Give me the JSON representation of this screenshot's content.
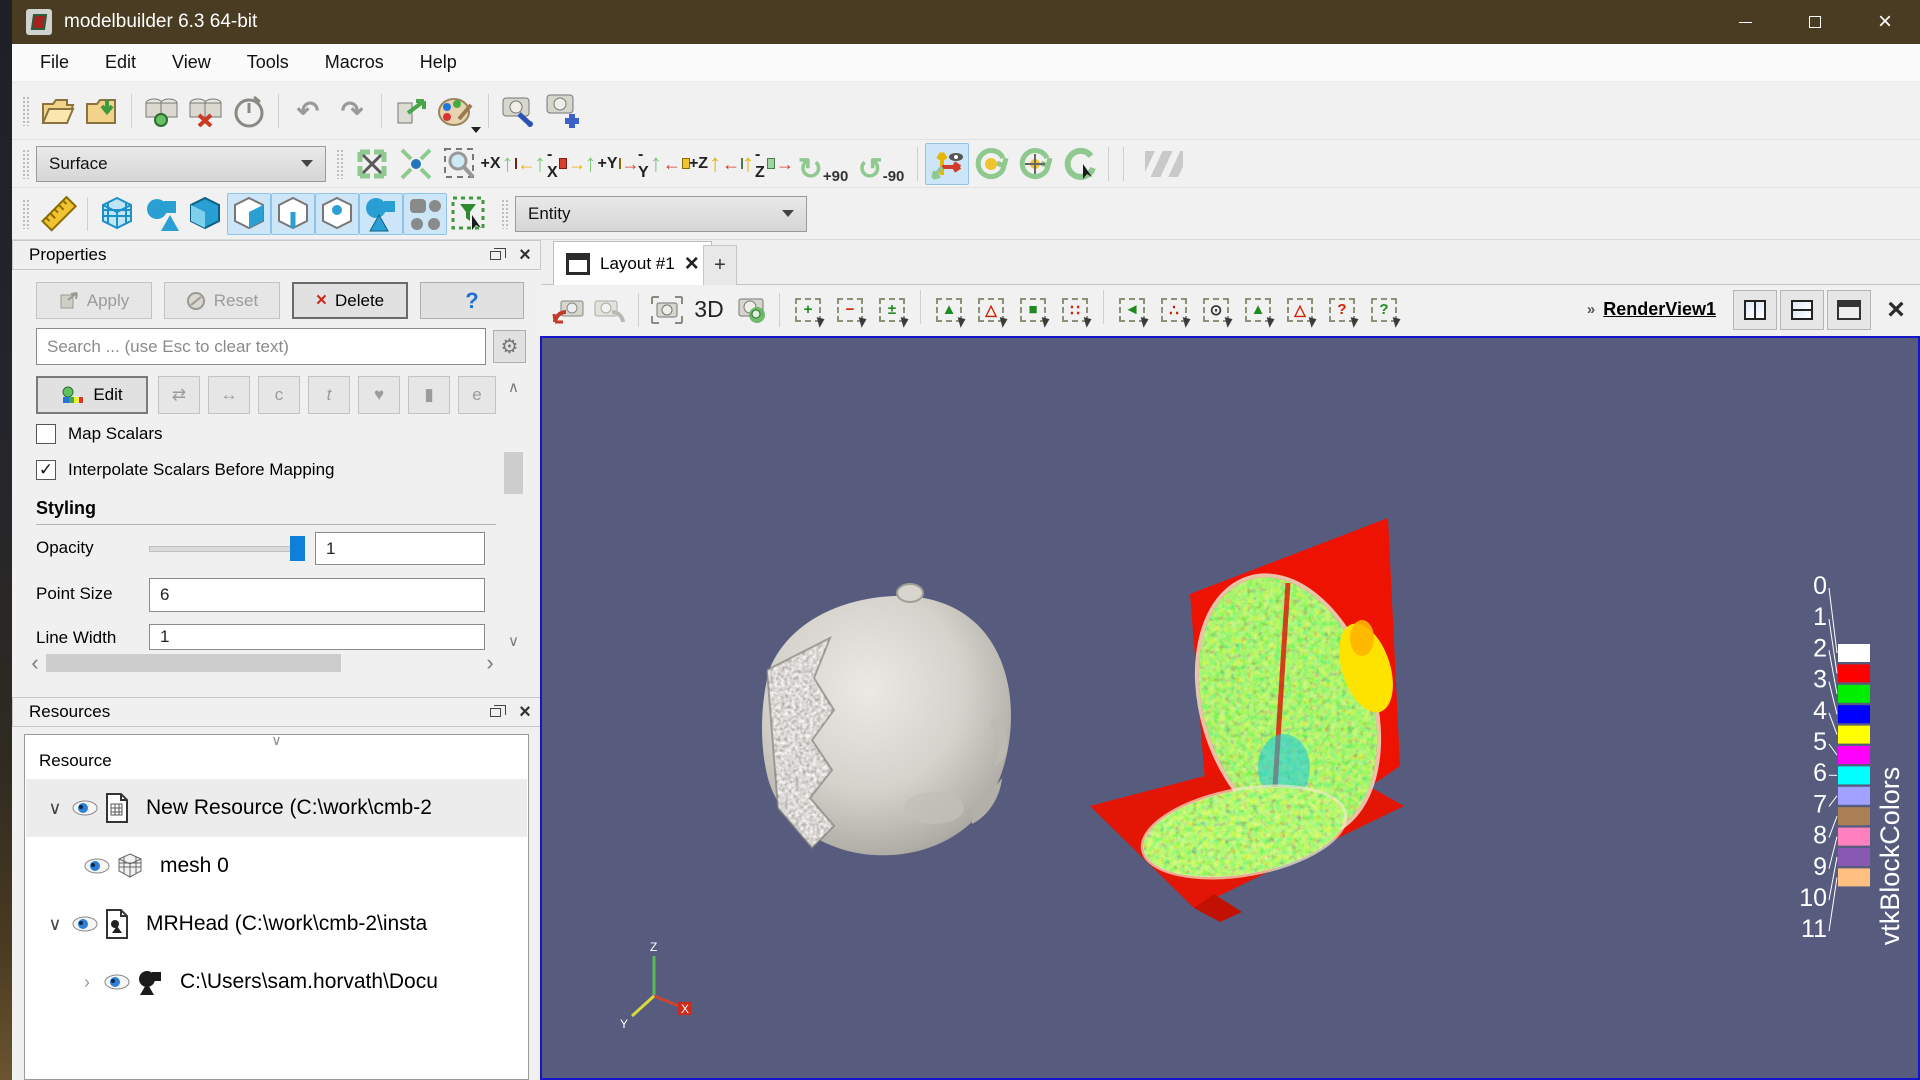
{
  "window": {
    "title": "modelbuilder 6.3 64-bit"
  },
  "menubar": {
    "items": [
      "File",
      "Edit",
      "View",
      "Tools",
      "Macros",
      "Help"
    ]
  },
  "glyphs": {
    "close": "×",
    "plus": "+",
    "gear": "⚙",
    "chevron_up": "∧",
    "chevron_down": "∨",
    "chevron_left": "‹",
    "chevron_right": "›",
    "overflow": "»",
    "check": "✓",
    "undo": "↶",
    "redo": "↷"
  },
  "toolbars": {
    "representation_combo": {
      "value": "Surface"
    },
    "entity_combo": {
      "value": "Entity"
    },
    "camera": {
      "axis_buttons": [
        {
          "name": "set-view-plus-x",
          "label": "+X"
        },
        {
          "name": "set-view-minus-x",
          "label": "-X"
        },
        {
          "name": "set-view-plus-y",
          "label": "+Y"
        },
        {
          "name": "set-view-minus-y",
          "label": "-Y"
        },
        {
          "name": "set-view-plus-z",
          "label": "+Z"
        },
        {
          "name": "set-view-minus-z",
          "label": "-Z"
        }
      ],
      "rotate_buttons": [
        {
          "name": "rotate-90-clockwise",
          "label": "+90"
        },
        {
          "name": "rotate-90-counterclockwise",
          "label": "-90"
        }
      ]
    }
  },
  "properties_panel": {
    "title": "Properties",
    "buttons": {
      "apply": "Apply",
      "reset": "Reset",
      "delete": "Delete",
      "help": "?"
    },
    "search_placeholder": "Search ... (use Esc to clear text)",
    "colormap": {
      "edit_label": "Edit",
      "icon_buttons": [
        {
          "name": "use-separate-colormap-button",
          "glyph": "⇄"
        },
        {
          "name": "rescale-to-data-range-button",
          "glyph": "↔"
        },
        {
          "name": "rescale-to-custom-range-button",
          "glyph": "c"
        },
        {
          "name": "rescale-to-temporal-range-button",
          "glyph": "t"
        },
        {
          "name": "choose-preset-button",
          "glyph": "♥"
        },
        {
          "name": "show-color-legend-button",
          "glyph": "▮"
        },
        {
          "name": "edit-color-legend-button",
          "glyph": "e"
        }
      ]
    },
    "checkboxes": [
      {
        "label": "Map Scalars",
        "checked": false
      },
      {
        "label": "Interpolate Scalars Before Mapping",
        "checked": true
      }
    ],
    "styling": {
      "section_title": "Styling",
      "opacity": {
        "label": "Opacity",
        "value": "1"
      },
      "point_size": {
        "label": "Point Size",
        "value": "6"
      },
      "line_width": {
        "label": "Line Width",
        "value": "1"
      }
    }
  },
  "resources_panel": {
    "title": "Resources",
    "column_header": "Resource",
    "tree": [
      {
        "label": "New Resource (C:\\work\\cmb-2",
        "expanded": true,
        "visible": true,
        "selected": true
      },
      {
        "label": "mesh 0",
        "visible": true
      },
      {
        "label": "MRHead (C:\\work\\cmb-2\\insta",
        "expanded": true,
        "visible": true
      },
      {
        "label": "C:\\Users\\sam.horvath\\Docu",
        "collapsed": true,
        "visible": true
      }
    ]
  },
  "viewport": {
    "tab": {
      "label": "Layout #1"
    },
    "new_tab_label": "+",
    "toolbar": {
      "mode_label": "3D",
      "selection_icons": [
        {
          "name": "add-selection-button",
          "glyph": "+",
          "tone": "gn"
        },
        {
          "name": "subtract-selection-button",
          "glyph": "−",
          "tone": "rd"
        },
        {
          "name": "toggle-selection-button",
          "glyph": "±",
          "tone": "gn"
        },
        {
          "name": "select-cells-on-button",
          "glyph": "▲",
          "tone": "gn"
        },
        {
          "name": "select-points-on-button",
          "glyph": "△",
          "tone": "rd"
        },
        {
          "name": "select-cells-through-button",
          "glyph": "■",
          "tone": "gn"
        },
        {
          "name": "select-points-through-button",
          "glyph": "∷",
          "tone": "rd"
        },
        {
          "name": "select-cells-polygon-button",
          "glyph": "◄",
          "tone": "gn"
        },
        {
          "name": "select-points-polygon-button",
          "glyph": "∴",
          "tone": "rd"
        },
        {
          "name": "zoom-to-selection-button",
          "glyph": "⊙",
          "tone": "dk"
        },
        {
          "name": "interactive-select-cells-button",
          "glyph": "▲",
          "tone": "gn"
        },
        {
          "name": "interactive-select-points-button",
          "glyph": "△",
          "tone": "rd"
        },
        {
          "name": "hover-points-button",
          "glyph": "?",
          "tone": "rd"
        },
        {
          "name": "hover-cells-button",
          "glyph": "?",
          "tone": "gn"
        }
      ]
    },
    "view_name": "RenderView1",
    "legend": {
      "title": "vtkBlockColors",
      "entries": [
        {
          "label": "0",
          "color": "#ffffff"
        },
        {
          "label": "1",
          "color": "#ff0000"
        },
        {
          "label": "2",
          "color": "#00ee00"
        },
        {
          "label": "3",
          "color": "#0000ff"
        },
        {
          "label": "4",
          "color": "#ffff00"
        },
        {
          "label": "5",
          "color": "#ff00ff"
        },
        {
          "label": "6",
          "color": "#00ffff"
        },
        {
          "label": "7",
          "color": "#a1a1ff"
        },
        {
          "label": "8",
          "color": "#ab8055"
        },
        {
          "label": "9",
          "color": "#ff80bf"
        },
        {
          "label": "10",
          "color": "#8859b3"
        },
        {
          "label": "11",
          "color": "#ffbf80"
        }
      ]
    },
    "orientation_axes": {
      "x": "X",
      "y": "Y",
      "z": "Z"
    }
  }
}
